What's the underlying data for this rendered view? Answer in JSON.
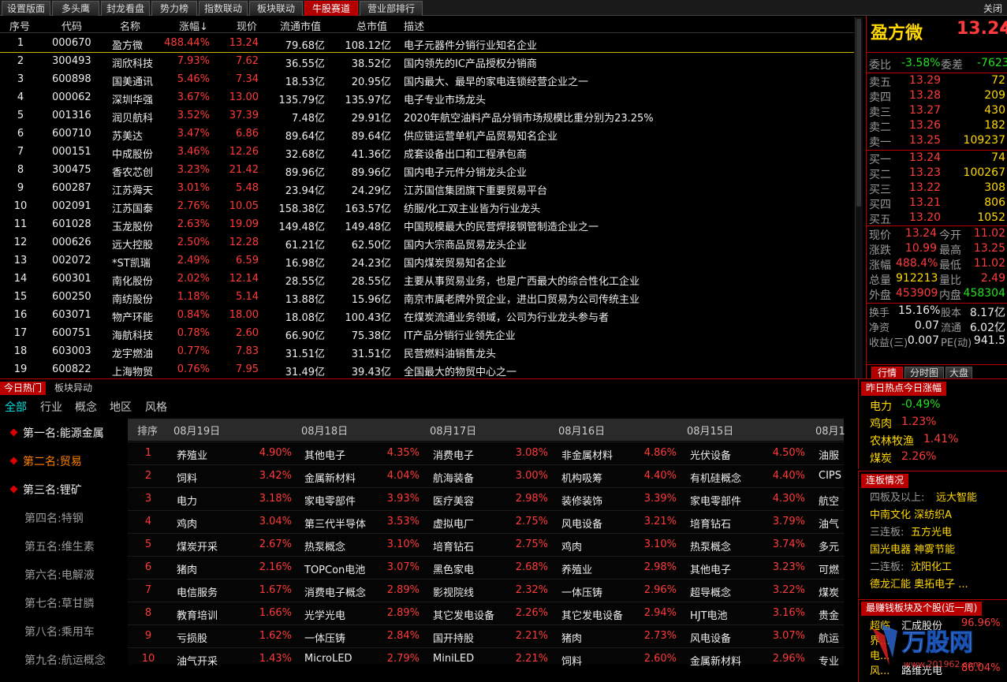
{
  "tabs": [
    "设置版面",
    "多头鹰",
    "封龙看盘",
    "势力榜",
    "指数联动",
    "板块联动",
    "牛股赛道",
    "营业部排行"
  ],
  "active_tab": "牛股赛道",
  "close_label": "关闭",
  "table": {
    "headers": {
      "idx": "序号",
      "code": "代码",
      "name": "名称",
      "chg": "涨幅↓",
      "price": "现价",
      "float_cap": "流通市值",
      "total_cap": "总市值",
      "desc": "描述"
    },
    "rows": [
      [
        "1",
        "000670",
        "盈方微",
        "488.44%",
        "13.24",
        "79.68亿",
        "108.12亿",
        "电子元器件分销行业知名企业"
      ],
      [
        "2",
        "300493",
        "润欣科技",
        "7.93%",
        "7.62",
        "36.55亿",
        "38.52亿",
        "国内领先的IC产品授权分销商"
      ],
      [
        "3",
        "600898",
        "国美通讯",
        "5.46%",
        "7.34",
        "18.53亿",
        "20.95亿",
        "国内最大、最早的家电连锁经营企业之一"
      ],
      [
        "4",
        "000062",
        "深圳华强",
        "3.67%",
        "13.00",
        "135.79亿",
        "135.97亿",
        "电子专业市场龙头"
      ],
      [
        "5",
        "001316",
        "润贝航科",
        "3.52%",
        "37.39",
        "7.48亿",
        "29.91亿",
        "2020年航空油料产品分销市场规模比重分别为23.25%"
      ],
      [
        "6",
        "600710",
        "苏美达",
        "3.47%",
        "6.86",
        "89.64亿",
        "89.64亿",
        "供应链运营单机产品贸易知名企业"
      ],
      [
        "7",
        "000151",
        "中成股份",
        "3.46%",
        "12.26",
        "32.68亿",
        "41.36亿",
        "成套设备出口和工程承包商"
      ],
      [
        "8",
        "300475",
        "香农芯创",
        "3.23%",
        "21.42",
        "89.96亿",
        "89.96亿",
        "国内电子元件分销龙头企业"
      ],
      [
        "9",
        "600287",
        "江苏舜天",
        "3.01%",
        "5.48",
        "23.94亿",
        "24.29亿",
        "江苏国信集团旗下重要贸易平台"
      ],
      [
        "10",
        "002091",
        "江苏国泰",
        "2.76%",
        "10.05",
        "158.38亿",
        "163.57亿",
        "纺服/化工双主业皆为行业龙头"
      ],
      [
        "11",
        "601028",
        "玉龙股份",
        "2.63%",
        "19.09",
        "149.48亿",
        "149.48亿",
        "中国规模最大的民营焊接钢管制造企业之一"
      ],
      [
        "12",
        "000626",
        "远大控股",
        "2.50%",
        "12.28",
        "61.21亿",
        "62.50亿",
        "国内大宗商品贸易龙头企业"
      ],
      [
        "13",
        "002072",
        "*ST凯瑞",
        "2.49%",
        "6.59",
        "16.98亿",
        "24.23亿",
        "国内煤炭贸易知名企业"
      ],
      [
        "14",
        "600301",
        "南化股份",
        "2.02%",
        "12.14",
        "28.55亿",
        "28.55亿",
        "主要从事贸易业务，也是广西最大的综合性化工企业"
      ],
      [
        "15",
        "600250",
        "南纺股份",
        "1.18%",
        "5.14",
        "13.88亿",
        "15.96亿",
        "南京市属老牌外贸企业，进出口贸易为公司传统主业"
      ],
      [
        "16",
        "603071",
        "物产环能",
        "0.84%",
        "18.00",
        "18.08亿",
        "100.43亿",
        "在煤炭流通业务领域，公司为行业龙头参与者"
      ],
      [
        "17",
        "600751",
        "海航科技",
        "0.78%",
        "2.60",
        "66.90亿",
        "75.38亿",
        "IT产品分销行业领先企业"
      ],
      [
        "18",
        "603003",
        "龙宇燃油",
        "0.77%",
        "7.83",
        "31.51亿",
        "31.51亿",
        "民营燃料油销售龙头"
      ],
      [
        "19",
        "600822",
        "上海物贸",
        "0.76%",
        "7.95",
        "31.49亿",
        "39.43亿",
        "全国最大的物贸中心之一"
      ]
    ]
  },
  "quote": {
    "name": "盈方微",
    "price": "13.24",
    "price_tail": "4",
    "weibi_label": "委比",
    "weibi": "-3.58%",
    "weicha_label": "委差",
    "weicha": "-7623",
    "asks": [
      [
        "卖五",
        "13.29",
        "72"
      ],
      [
        "卖四",
        "13.28",
        "209"
      ],
      [
        "卖三",
        "13.27",
        "430"
      ],
      [
        "卖二",
        "13.26",
        "182"
      ],
      [
        "卖一",
        "13.25",
        "109237"
      ]
    ],
    "bids": [
      [
        "买一",
        "13.24",
        "74"
      ],
      [
        "买二",
        "13.23",
        "100267"
      ],
      [
        "买三",
        "13.22",
        "308"
      ],
      [
        "买四",
        "13.21",
        "806"
      ],
      [
        "买五",
        "13.20",
        "1052"
      ]
    ],
    "stats": [
      [
        "现价",
        "13.24",
        "今开",
        "11.02"
      ],
      [
        "涨跌",
        "10.99",
        "最高",
        "13.25"
      ],
      [
        "涨幅",
        "488.4%",
        "最低",
        "11.02"
      ],
      [
        "总量",
        "912213",
        "量比",
        "2.49"
      ],
      [
        "外盘",
        "453909",
        "内盘",
        "458304"
      ]
    ],
    "stats2": [
      [
        "换手",
        "15.16%",
        "股本",
        "8.17亿"
      ],
      [
        "净资",
        "0.07",
        "流通",
        "6.02亿"
      ],
      [
        "收益(三)",
        "0.007",
        "PE(动)",
        "941.5"
      ]
    ],
    "tabs": [
      "行情",
      "分时图",
      "大盘"
    ]
  },
  "hot": {
    "tabs": [
      "今日热门",
      "板块异动"
    ],
    "cats": [
      "全部",
      "行业",
      "概念",
      "地区",
      "风格"
    ],
    "ranks": [
      "第一名:能源金属",
      "第二名:贸易",
      "第三名:锂矿",
      "第四名:特钢",
      "第五名:维生素",
      "第六名:电解液",
      "第七名:草甘膦",
      "第八名:乘用车",
      "第九名:航运概念"
    ],
    "rank_col": "排序",
    "dates": [
      "08月19日",
      "08月18日",
      "08月17日",
      "08月16日",
      "08月15日",
      "08月1"
    ],
    "rows": [
      [
        [
          "养殖业",
          "4.90%"
        ],
        [
          "其他电子",
          "4.35%"
        ],
        [
          "消费电子",
          "3.08%"
        ],
        [
          "非金属材料",
          "4.86%"
        ],
        [
          "光伏设备",
          "4.50%"
        ],
        [
          "油服",
          ""
        ]
      ],
      [
        [
          "饲料",
          "3.42%"
        ],
        [
          "金属新材料",
          "4.04%"
        ],
        [
          "航海装备",
          "3.00%"
        ],
        [
          "机构吸筹",
          "4.40%"
        ],
        [
          "有机硅概念",
          "4.40%"
        ],
        [
          "CIPS",
          ""
        ]
      ],
      [
        [
          "电力",
          "3.18%"
        ],
        [
          "家电零部件",
          "3.93%"
        ],
        [
          "医疗美容",
          "2.98%"
        ],
        [
          "装修装饰",
          "3.39%"
        ],
        [
          "家电零部件",
          "4.30%"
        ],
        [
          "航空",
          ""
        ]
      ],
      [
        [
          "鸡肉",
          "3.04%"
        ],
        [
          "第三代半导体",
          "3.53%"
        ],
        [
          "虚拟电厂",
          "2.75%"
        ],
        [
          "风电设备",
          "3.21%"
        ],
        [
          "培育钻石",
          "3.79%"
        ],
        [
          "油气",
          ""
        ]
      ],
      [
        [
          "煤炭开采",
          "2.67%"
        ],
        [
          "热泵概念",
          "3.10%"
        ],
        [
          "培育钻石",
          "2.75%"
        ],
        [
          "鸡肉",
          "3.10%"
        ],
        [
          "热泵概念",
          "3.74%"
        ],
        [
          "多元",
          ""
        ]
      ],
      [
        [
          "猪肉",
          "2.16%"
        ],
        [
          "TOPCon电池",
          "3.07%"
        ],
        [
          "黑色家电",
          "2.68%"
        ],
        [
          "养殖业",
          "2.98%"
        ],
        [
          "其他电子",
          "3.23%"
        ],
        [
          "可燃",
          ""
        ]
      ],
      [
        [
          "电信服务",
          "1.67%"
        ],
        [
          "消费电子概念",
          "2.89%"
        ],
        [
          "影视院线",
          "2.32%"
        ],
        [
          "一体压铸",
          "2.96%"
        ],
        [
          "超导概念",
          "3.22%"
        ],
        [
          "煤炭",
          ""
        ]
      ],
      [
        [
          "教育培训",
          "1.66%"
        ],
        [
          "光学光电",
          "2.89%"
        ],
        [
          "其它发电设备",
          "2.26%"
        ],
        [
          "其它发电设备",
          "2.94%"
        ],
        [
          "HJT电池",
          "3.16%"
        ],
        [
          "贵金",
          ""
        ]
      ],
      [
        [
          "亏损股",
          "1.62%"
        ],
        [
          "一体压铸",
          "2.84%"
        ],
        [
          "国开持股",
          "2.21%"
        ],
        [
          "猪肉",
          "2.73%"
        ],
        [
          "风电设备",
          "3.07%"
        ],
        [
          "航运",
          ""
        ]
      ],
      [
        [
          "油气开采",
          "1.43%"
        ],
        [
          "MicroLED",
          "2.79%"
        ],
        [
          "MiniLED",
          "2.21%"
        ],
        [
          "饲料",
          "2.60%"
        ],
        [
          "金属新材料",
          "2.96%"
        ],
        [
          "专业",
          ""
        ]
      ]
    ]
  },
  "yesterday": {
    "title": "昨日热点今日涨幅",
    "items": [
      [
        "电力",
        "-0.49%"
      ],
      [
        "鸡肉",
        "1.23%"
      ],
      [
        "农林牧渔",
        "1.41%"
      ],
      [
        "煤炭",
        "2.26%"
      ]
    ]
  },
  "lianban": {
    "title": "连板情况",
    "lines": [
      [
        "四板及以上:",
        "远大智能"
      ],
      [
        "",
        "中南文化  深纺织A"
      ],
      [
        "三连板:",
        "五方光电"
      ],
      [
        "",
        "国光电器  神雾节能"
      ],
      [
        "二连板:",
        "沈阳化工"
      ],
      [
        "",
        "德龙汇能  奥拓电子   ..."
      ]
    ]
  },
  "money": {
    "title": "最赚钱板块及个股(近一周)",
    "items": [
      [
        "超临",
        "汇成股份",
        "96.96%"
      ],
      [
        "界...",
        "",
        ""
      ],
      [
        "电...",
        "",
        ""
      ],
      [
        "风...",
        "路维光电",
        "86.04%"
      ]
    ]
  },
  "watermark": {
    "text": "万股网",
    "url": "www.201962.com"
  }
}
